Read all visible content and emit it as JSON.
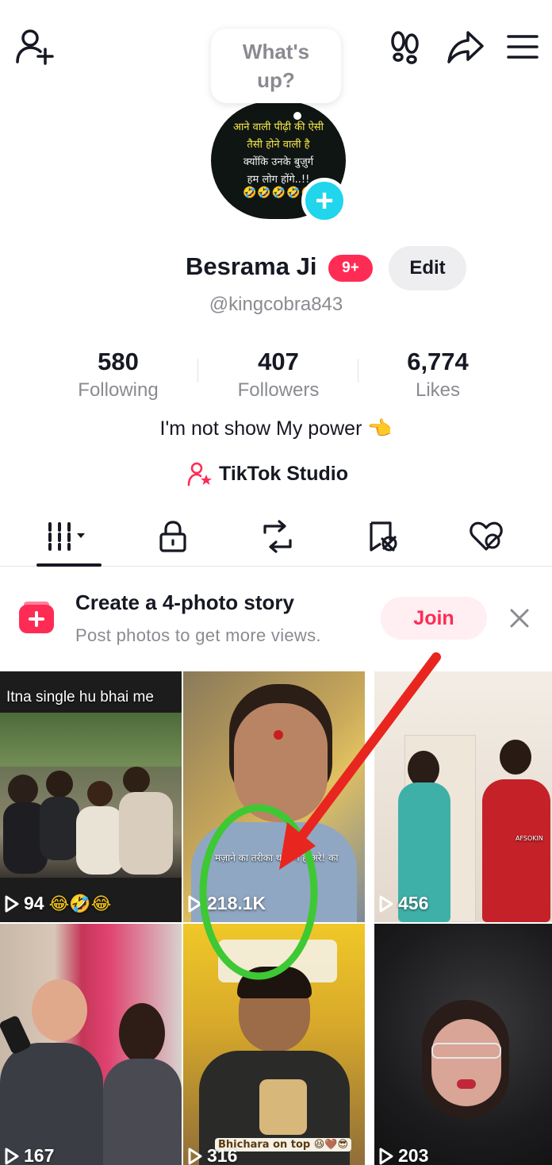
{
  "header": {
    "bubble_text": "What's up?",
    "icons": [
      "add-friend-icon",
      "footprint-icon",
      "share-icon",
      "menu-icon"
    ]
  },
  "avatar": {
    "line1": "आने वाली पीढ़ी की ऐसी",
    "line2": "तैसी होने वाली है",
    "line3": "क्योंकि उनके बुज़ुर्ग",
    "line4": "हम लोग होंगे..!!",
    "emoji": "🤣🤣🤣🤣🤣"
  },
  "profile": {
    "name": "Besrama Ji",
    "badge": "9+",
    "edit_label": "Edit",
    "handle": "@kingcobra843",
    "bio": "I'm not show My power 👈",
    "studio_label": "TikTok Studio"
  },
  "stats": [
    {
      "value": "580",
      "label": "Following"
    },
    {
      "value": "407",
      "label": "Followers"
    },
    {
      "value": "6,774",
      "label": "Likes"
    }
  ],
  "tabs": [
    "videos-grid-icon",
    "lock-icon",
    "repost-icon",
    "favorites-icon",
    "liked-icon"
  ],
  "story_banner": {
    "title": "Create a 4-photo story",
    "subtitle": "Post photos to get more views.",
    "join_label": "Join"
  },
  "videos": [
    {
      "views": "94",
      "caption": "Itna single hu bhai me",
      "emoji": "😂🤣😂"
    },
    {
      "views": "218.1K",
      "overlay": "मज़ाने का तरीका थ... ग है अरे! का"
    },
    {
      "views": "456",
      "overlay": "AFSOKIN"
    },
    {
      "views": "167"
    },
    {
      "views": "316",
      "overlay": "Bhichara on top 😆🤎😎"
    },
    {
      "views": "203"
    }
  ],
  "colors": {
    "accent": "#fe2c55",
    "avatar_plus": "#20d5ec",
    "annotation": "#e8261f",
    "highlight_circle": "#3ec834"
  }
}
